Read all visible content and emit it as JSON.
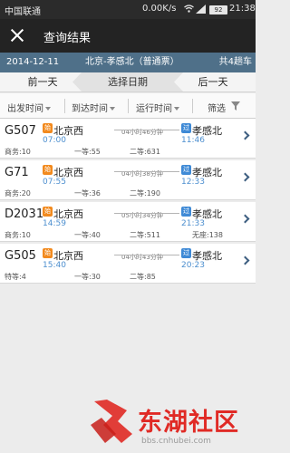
{
  "status_bar": {
    "carrier": "中国联通",
    "net_speed": "0.00K/s",
    "battery": "92",
    "time": "21:38"
  },
  "title_bar": {
    "title": "查询结果"
  },
  "info_bar": {
    "date": "2014-12-11",
    "route": "北京-孝感北（普通票）",
    "count": "共4趟车"
  },
  "day_nav": {
    "prev": "前一天",
    "pick": "选择日期",
    "next": "后一天"
  },
  "sort_bar": {
    "depart": "出发时间",
    "arrive": "到达时间",
    "duration": "运行时间",
    "filter": "筛选"
  },
  "trains": [
    {
      "number": "G507",
      "from_badge": "始",
      "from": "北京西",
      "dep_time": "07:00",
      "duration": "04小时46分钟",
      "to_badge": "过",
      "to": "孝感北",
      "arr_time": "11:46",
      "seats": [
        "商务:10",
        "一等:55",
        "二等:631"
      ]
    },
    {
      "number": "G71",
      "from_badge": "始",
      "from": "北京西",
      "dep_time": "07:55",
      "duration": "04小时38分钟",
      "to_badge": "过",
      "to": "孝感北",
      "arr_time": "12:33",
      "seats": [
        "商务:20",
        "一等:36",
        "二等:190"
      ]
    },
    {
      "number": "D2031",
      "from_badge": "始",
      "from": "北京西",
      "dep_time": "14:59",
      "duration": "05小时34分钟",
      "to_badge": "过",
      "to": "孝感北",
      "arr_time": "21:33",
      "seats": [
        "商务:10",
        "一等:40",
        "二等:511",
        "无座:138"
      ]
    },
    {
      "number": "G505",
      "from_badge": "始",
      "from": "北京西",
      "dep_time": "15:40",
      "duration": "04小时43分钟",
      "to_badge": "过",
      "to": "孝感北",
      "arr_time": "20:23",
      "seats": [
        "特等:4",
        "一等:30",
        "二等:85"
      ]
    }
  ],
  "watermark": {
    "brand": "东湖社区",
    "url": "bbs.cnhubei.com"
  },
  "colors": {
    "info_bar": "#4f7089",
    "time_text": "#4d8fcf",
    "start_badge": "#f28a1e",
    "pass_badge": "#3f8ad6",
    "brand_red": "#e02a25"
  },
  "icons": [
    "close-icon",
    "filter-icon",
    "chevron-right-icon",
    "wifi-icon",
    "signal-icon",
    "battery-icon"
  ]
}
